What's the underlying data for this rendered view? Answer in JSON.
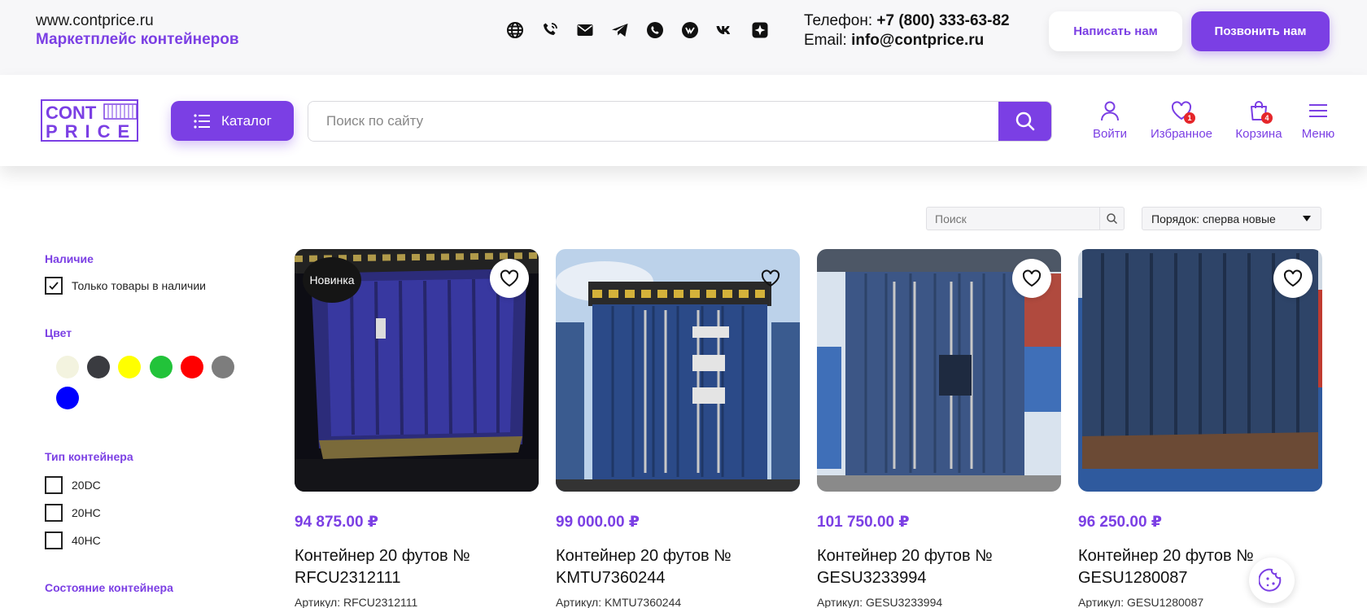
{
  "topbar": {
    "site_url": "www.contprice.ru",
    "tagline": "Маркетплейс контейнеров",
    "phone_label": "Телефон: ",
    "phone": "+7 (800) 333-63-82",
    "email_label": "Email: ",
    "email": "info@contprice.ru",
    "write_button": "Написать нам",
    "call_button": "Позвонить нам",
    "socials": [
      "globe-icon",
      "phone-icon",
      "mail-icon",
      "telegram-icon",
      "whatsapp-icon",
      "vk-video-icon",
      "vk-icon",
      "star-icon"
    ]
  },
  "header": {
    "logo_line1": "CONT",
    "logo_line2": "PRICE",
    "catalog_label": "Каталог",
    "search_placeholder": "Поиск по сайту",
    "login_label": "Войти",
    "favorites_label": "Избранное",
    "favorites_count": "1",
    "cart_label": "Корзина",
    "cart_count": "4",
    "menu_label": "Меню"
  },
  "toolbar": {
    "search_placeholder": "Поиск",
    "sort_label": "Порядок: сперва новые"
  },
  "filters": {
    "availability_title": "Наличие",
    "in_stock_label": "Только товары в наличии",
    "color_title": "Цвет",
    "colors": [
      "#f3f3df",
      "#3a3b40",
      "#ffff00",
      "#22c33a",
      "#ff0000",
      "#7d7d7d",
      "#0000ff"
    ],
    "type_title": "Тип контейнера",
    "types": [
      "20DC",
      "20HC",
      "40HC"
    ],
    "condition_title": "Состояние контейнера"
  },
  "products": [
    {
      "badge": "Новинка",
      "price": "94 875.00 ₽",
      "name1": "Контейнер 20 футов №",
      "name2": "RFCU2312111",
      "sku": "Артикул: RFCU2312111"
    },
    {
      "badge": "",
      "price": "99 000.00 ₽",
      "name1": "Контейнер 20 футов №",
      "name2": "KMTU7360244",
      "sku": "Артикул: KMTU7360244"
    },
    {
      "badge": "",
      "price": "101 750.00 ₽",
      "name1": "Контейнер 20 футов №",
      "name2": "GESU3233994",
      "sku": "Артикул: GESU3233994"
    },
    {
      "badge": "",
      "price": "96 250.00 ₽",
      "name1": "Контейнер 20 футов №",
      "name2": "GESU1280087",
      "sku": "Артикул: GESU1280087"
    }
  ],
  "colors": {
    "accent": "#7b3fe4",
    "badge_red": "#e5262a"
  }
}
